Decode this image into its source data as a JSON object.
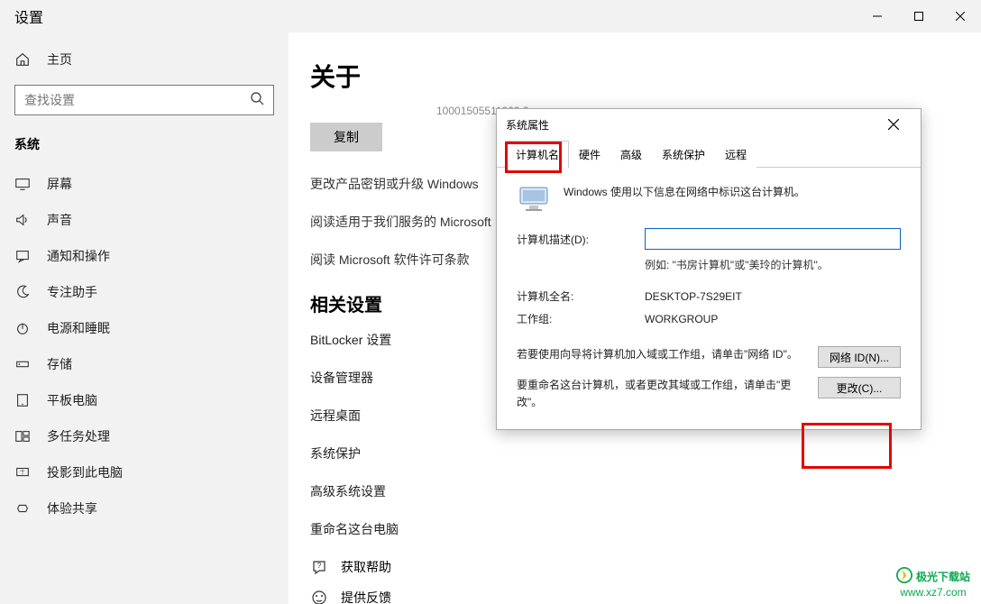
{
  "window": {
    "title": "设置"
  },
  "sidebar": {
    "home": "主页",
    "search_placeholder": "查找设置",
    "group": "系统",
    "items": [
      {
        "label": "屏幕"
      },
      {
        "label": "声音"
      },
      {
        "label": "通知和操作"
      },
      {
        "label": "专注助手"
      },
      {
        "label": "电源和睡眠"
      },
      {
        "label": "存储"
      },
      {
        "label": "平板电脑"
      },
      {
        "label": "多任务处理"
      },
      {
        "label": "投影到此电脑"
      },
      {
        "label": "体验共享"
      }
    ]
  },
  "main": {
    "title": "关于",
    "faint_id": "10001505511000.0",
    "copy_btn": "复制",
    "links": [
      "更改产品密钥或升级 Windows",
      "阅读适用于我们服务的 Microsoft",
      "阅读 Microsoft 软件许可条款"
    ],
    "related_title": "相关设置",
    "related": [
      "BitLocker 设置",
      "设备管理器",
      "远程桌面",
      "系统保护",
      "高级系统设置",
      "重命名这台电脑"
    ],
    "help": "获取帮助",
    "feedback": "提供反馈"
  },
  "dialog": {
    "title": "系统属性",
    "tabs": [
      "计算机名",
      "硬件",
      "高级",
      "系统保护",
      "远程"
    ],
    "info": "Windows 使用以下信息在网络中标识这台计算机。",
    "desc_label": "计算机描述(D):",
    "desc_value": "",
    "desc_hint": "例如: \"书房计算机\"或\"美玲的计算机\"。",
    "fullname_label": "计算机全名:",
    "fullname_value": "DESKTOP-7S29EIT",
    "workgroup_label": "工作组:",
    "workgroup_value": "WORKGROUP",
    "net_id_text": "若要使用向导将计算机加入域或工作组，请单击\"网络 ID\"。",
    "net_id_btn": "网络 ID(N)...",
    "change_text": "要重命名这台计算机，或者更改其域或工作组，请单击\"更改\"。",
    "change_btn": "更改(C)..."
  },
  "watermark": {
    "name": "极光下载站",
    "url": "www.xz7.com"
  }
}
